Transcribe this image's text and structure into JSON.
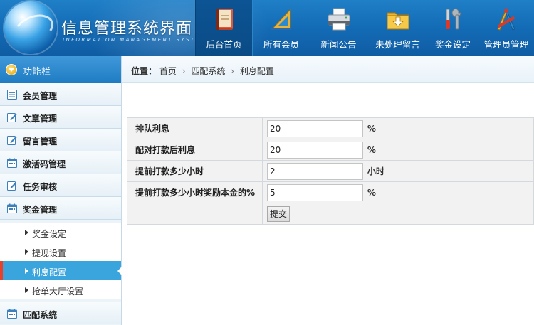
{
  "header": {
    "title": "信息管理系统界面",
    "subtitle": "INFORMATION MANAGEMENT SYSTEM GUI",
    "nav": [
      {
        "label": "后台首页",
        "icon": "book-icon",
        "active": true
      },
      {
        "label": "所有会员",
        "icon": "ruler-triangle-icon",
        "active": false
      },
      {
        "label": "新闻公告",
        "icon": "printer-icon",
        "active": false
      },
      {
        "label": "未处理留言",
        "icon": "folder-download-icon",
        "active": false
      },
      {
        "label": "奖金设定",
        "icon": "tools-icon",
        "active": false
      },
      {
        "label": "管理员管理",
        "icon": "drafting-tools-icon",
        "active": false
      }
    ]
  },
  "sidebar": {
    "title": "功能栏",
    "items": [
      {
        "label": "会员管理",
        "icon": "list-icon"
      },
      {
        "label": "文章管理",
        "icon": "edit-icon"
      },
      {
        "label": "留言管理",
        "icon": "edit-icon"
      },
      {
        "label": "激活码管理",
        "icon": "calendar-icon"
      },
      {
        "label": "任务审核",
        "icon": "edit-icon"
      },
      {
        "label": "奖金管理",
        "icon": "calendar-icon"
      }
    ],
    "subitems": [
      {
        "label": "奖金设定",
        "active": false
      },
      {
        "label": "提现设置",
        "active": false
      },
      {
        "label": "利息配置",
        "active": true
      },
      {
        "label": "抢单大厅设置",
        "active": false
      }
    ],
    "after_items": [
      {
        "label": "匹配系统",
        "icon": "calendar-icon"
      }
    ]
  },
  "breadcrumb": {
    "label": "位置：",
    "items": [
      "首页",
      "匹配系统",
      "利息配置"
    ],
    "separator": "›"
  },
  "form": {
    "rows": [
      {
        "label": "排队利息",
        "value": "20",
        "unit": "%"
      },
      {
        "label": "配对打款后利息",
        "value": "20",
        "unit": "%"
      },
      {
        "label": "提前打款多少小时",
        "value": "2",
        "unit": "小时"
      },
      {
        "label": "提前打款多少小时奖励本金的%",
        "value": "5",
        "unit": "%"
      }
    ],
    "submit_label": "提交"
  },
  "colors": {
    "header_blue": "#146db7",
    "active_sub": "#3aa4dc",
    "active_marker": "#e9402a"
  }
}
